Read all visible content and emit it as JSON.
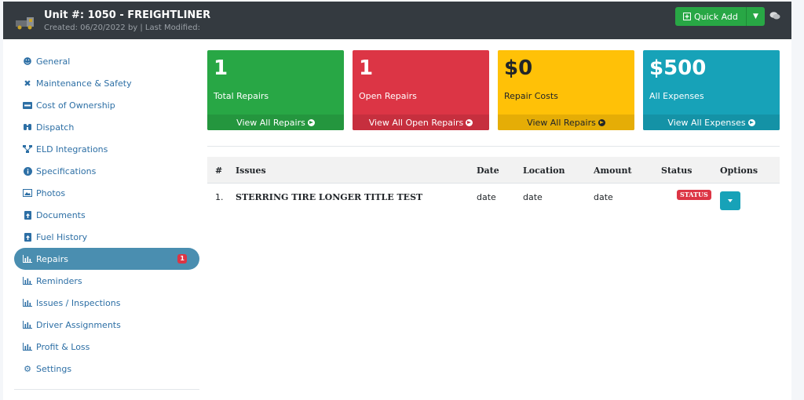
{
  "header": {
    "title": "Unit #: 1050 - FREIGHTLINER",
    "subtitle": "Created: 06/20/2022 by | Last Modified:",
    "quick_add_label": "Quick Add"
  },
  "sidebar": {
    "items": [
      {
        "label": "General",
        "icon": "user-icon"
      },
      {
        "label": "Maintenance & Safety",
        "icon": "tools-icon"
      },
      {
        "label": "Cost of Ownership",
        "icon": "money-icon"
      },
      {
        "label": "Dispatch",
        "icon": "binoculars-icon"
      },
      {
        "label": "ELD Integrations",
        "icon": "network-icon"
      },
      {
        "label": "Specifications",
        "icon": "info-icon"
      },
      {
        "label": "Photos",
        "icon": "image-icon"
      },
      {
        "label": "Documents",
        "icon": "file-icon"
      },
      {
        "label": "Fuel History",
        "icon": "file-icon"
      },
      {
        "label": "Repairs",
        "icon": "chart-icon",
        "badge": "1"
      },
      {
        "label": "Reminders",
        "icon": "chart-icon"
      },
      {
        "label": "Issues / Inspections",
        "icon": "chart-icon"
      },
      {
        "label": "Driver Assignments",
        "icon": "chart-icon"
      },
      {
        "label": "Profit & Loss",
        "icon": "chart-icon"
      },
      {
        "label": "Settings",
        "icon": "cogs-icon"
      }
    ]
  },
  "stats": [
    {
      "value": "1",
      "label": "Total Repairs",
      "link": "View All Repairs"
    },
    {
      "value": "1",
      "label": "Open Repairs",
      "link": "View All Open Repairs"
    },
    {
      "value": "$0",
      "label": "Repair Costs",
      "link": "View All Repairs"
    },
    {
      "value": "$500",
      "label": "All Expenses",
      "link": "View All Expenses"
    }
  ],
  "table": {
    "columns": [
      "#",
      "Issues",
      "Date",
      "Location",
      "Amount",
      "Status",
      "Options"
    ],
    "rows": [
      {
        "num": "1.",
        "issue": "STERRING TIRE LONGER TITLE TEST",
        "date": "date",
        "location": "date",
        "amount": "date",
        "status": "STATUS"
      }
    ]
  },
  "colors": {
    "header_bg": "#343a40",
    "green": "#28a745",
    "red": "#dc3545",
    "yellow": "#ffc107",
    "teal": "#17a2b8",
    "active_nav": "#4a8eb0"
  }
}
